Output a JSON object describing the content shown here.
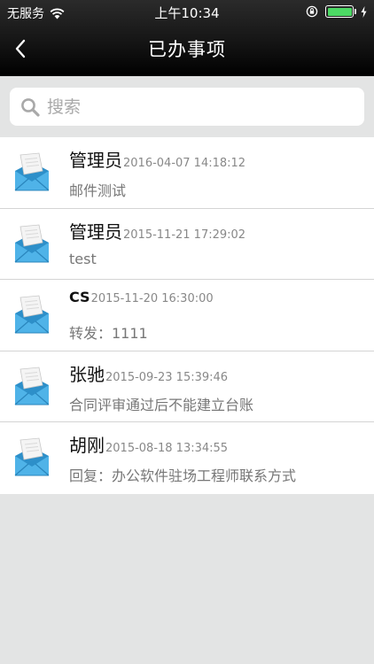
{
  "status_bar": {
    "carrier": "无服务",
    "time": "上午10:34"
  },
  "nav": {
    "title": "已办事项",
    "back_icon": "chevron-left-icon"
  },
  "search": {
    "placeholder": "搜索",
    "value": "",
    "icon": "search-icon"
  },
  "items": [
    {
      "name": "管理员",
      "date": "2016-04-07 14:18:12",
      "subject": "邮件测试"
    },
    {
      "name": "管理员",
      "date": "2015-11-21 17:29:02",
      "subject": "test"
    },
    {
      "name": "CS",
      "date": "2015-11-20 16:30:00",
      "subject": "转发：1111"
    },
    {
      "name": "张驰",
      "date": "2015-09-23 15:39:46",
      "subject": "合同评审通过后不能建立台账"
    },
    {
      "name": "胡刚",
      "date": "2015-08-18 13:34:55",
      "subject": "回复：办公软件驻场工程师联系方式"
    }
  ],
  "colors": {
    "battery": "#4cd964",
    "envelope": "#3a9ed6",
    "background": "#e3e4e4"
  }
}
